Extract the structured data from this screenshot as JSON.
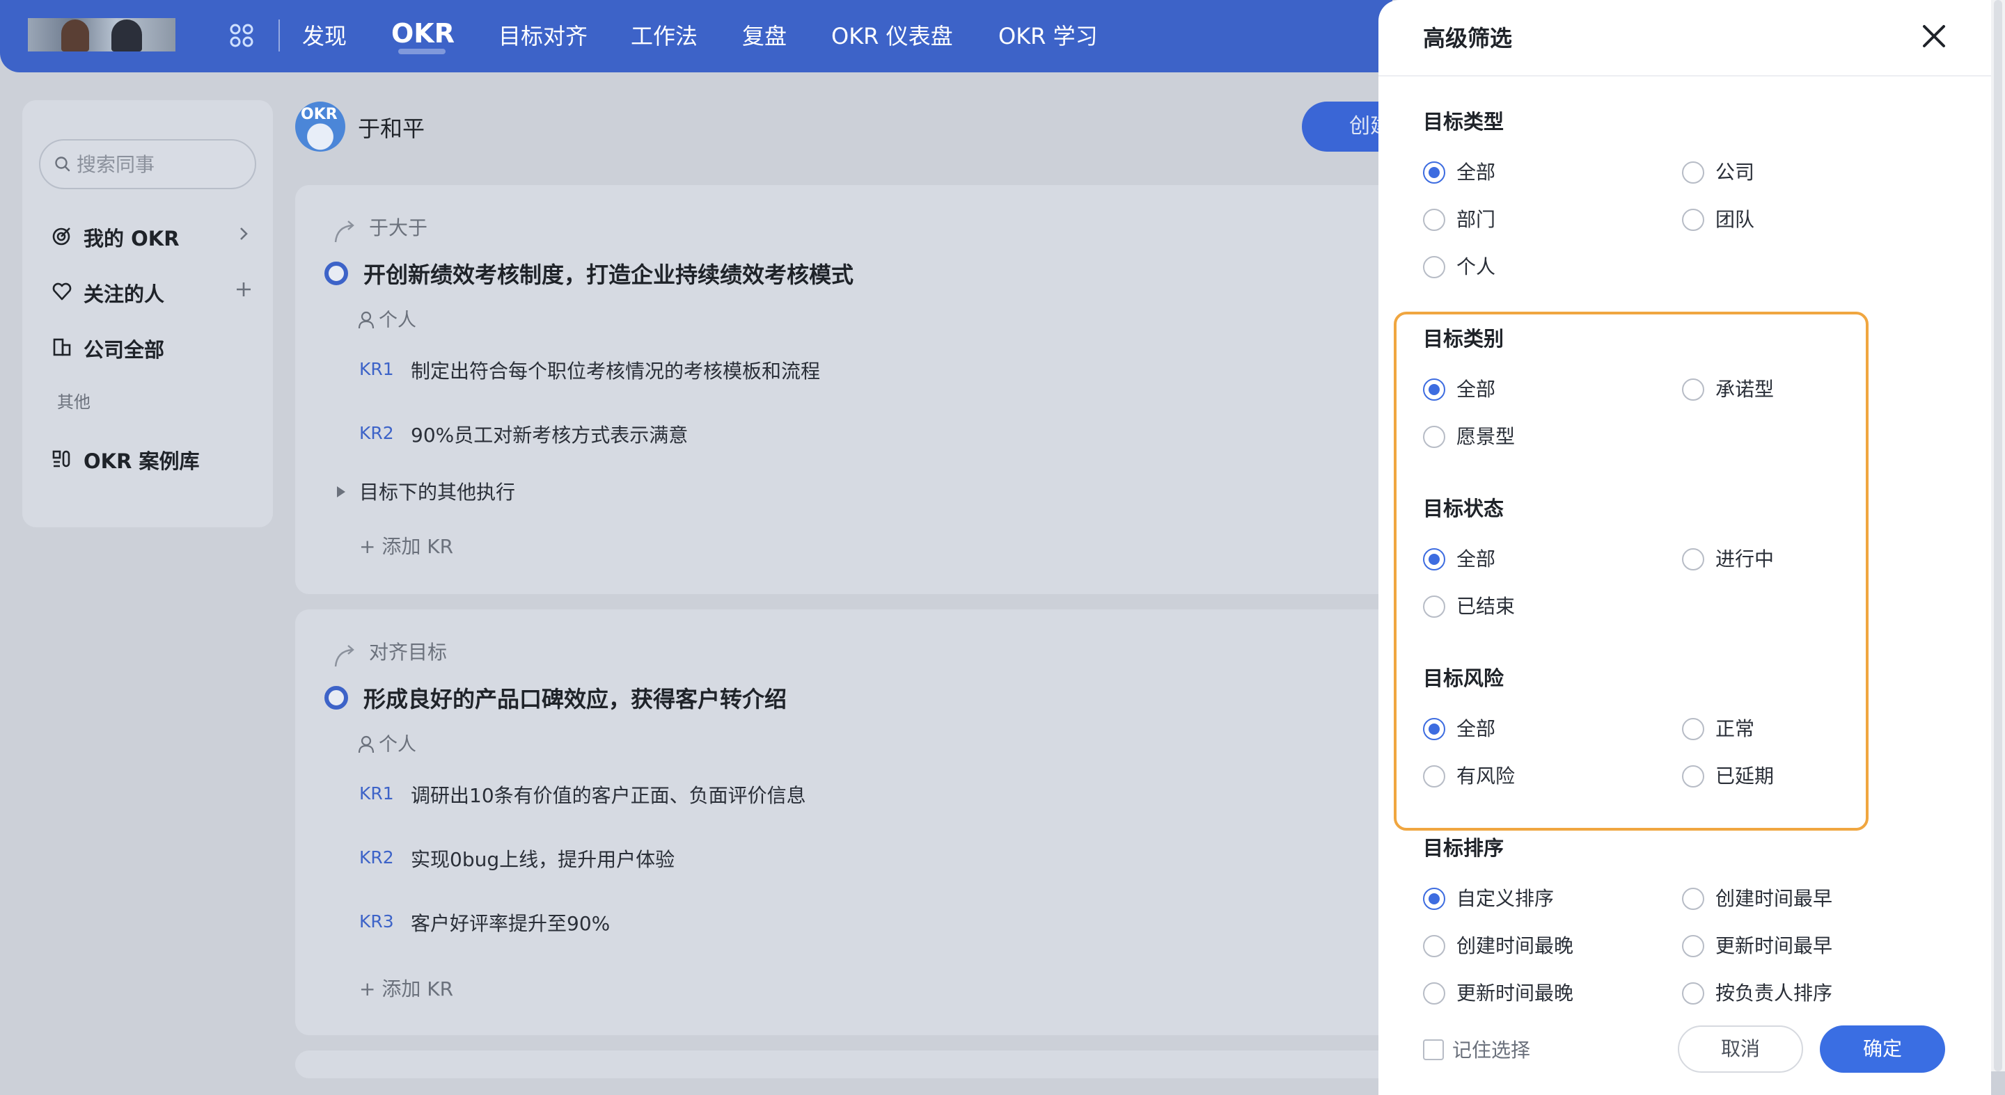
{
  "nav": {
    "items": [
      "发现",
      "OKR",
      "目标对齐",
      "工作法",
      "复盘",
      "OKR 仪表盘",
      "OKR 学习"
    ]
  },
  "sidebar": {
    "search_placeholder": "搜索同事",
    "items": [
      {
        "label": "我的 OKR",
        "icon": "target-icon"
      },
      {
        "label": "关注的人",
        "icon": "heart-icon"
      },
      {
        "label": "公司全部",
        "icon": "building-icon"
      }
    ],
    "section_label": "其他",
    "extra_item": {
      "label": "OKR 案例库",
      "icon": "case-library-icon"
    }
  },
  "main": {
    "avatar_text": "OKR",
    "owner_name": "于和平",
    "create_label": "创建",
    "cards": [
      {
        "parent": "于大于",
        "title": "开创新绩效考核制度，打造企业持续绩效考核模式",
        "owner": "个人",
        "krs": [
          {
            "tag": "KR1",
            "text": "制定出符合每个职位考核情况的考核模板和流程"
          },
          {
            "tag": "KR2",
            "text": "90%员工对新考核方式表示满意"
          }
        ],
        "more": "目标下的其他执行",
        "add": "+ 添加 KR"
      },
      {
        "parent": "对齐目标",
        "title": "形成良好的产品口碑效应，获得客户转介绍",
        "owner": "个人",
        "krs": [
          {
            "tag": "KR1",
            "text": "调研出10条有价值的客户正面、负面评价信息"
          },
          {
            "tag": "KR2",
            "text": "实现0bug上线，提升用户体验"
          },
          {
            "tag": "KR3",
            "text": "客户好评率提升至90%"
          }
        ],
        "add": "+ 添加 KR"
      }
    ]
  },
  "filter": {
    "title": "高级筛选",
    "groups": [
      {
        "title": "目标类型",
        "options": [
          "全部",
          "公司",
          "部门",
          "团队",
          "个人"
        ],
        "selected": "全部"
      },
      {
        "title": "目标类别",
        "options": [
          "全部",
          "承诺型",
          "愿景型"
        ],
        "selected": "全部"
      },
      {
        "title": "目标状态",
        "options": [
          "全部",
          "进行中",
          "已结束"
        ],
        "selected": "全部"
      },
      {
        "title": "目标风险",
        "options": [
          "全部",
          "正常",
          "有风险",
          "已延期"
        ],
        "selected": "全部"
      },
      {
        "title": "目标排序",
        "options": [
          "自定义排序",
          "创建时间最早",
          "创建时间最晚",
          "更新时间最早",
          "更新时间最晚",
          "按负责人排序"
        ],
        "selected": "自定义排序"
      }
    ],
    "remember_label": "记住选择",
    "cancel_label": "取消",
    "confirm_label": "确定",
    "highlight_color": "#f0a640",
    "accent_color": "#3d6ce0"
  }
}
